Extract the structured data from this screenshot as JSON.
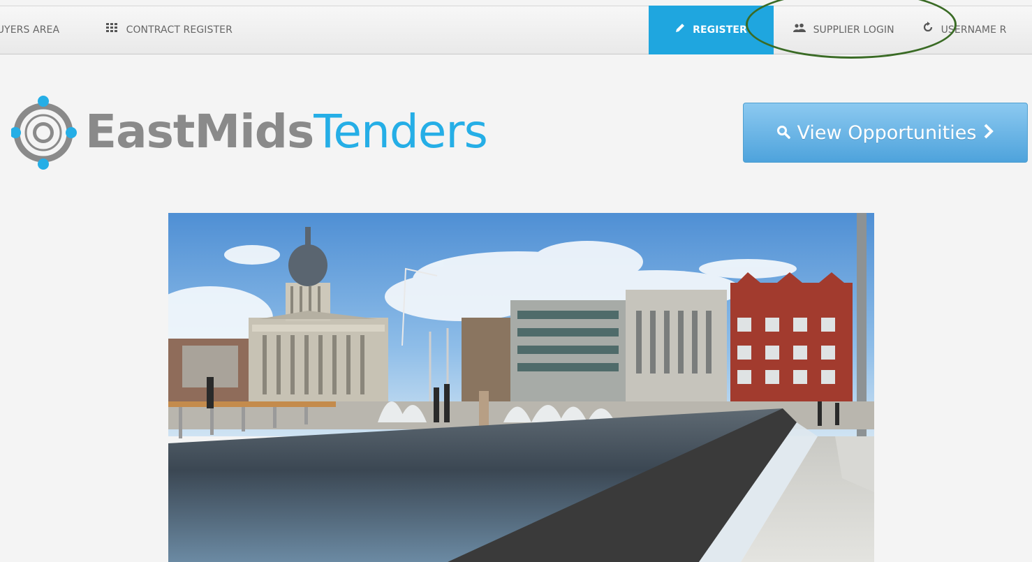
{
  "nav": {
    "buyers_area": "BUYERS AREA",
    "contract_register": "CONTRACT REGISTER",
    "register": "REGISTER",
    "supplier_login": "SUPPLIER LOGIN",
    "username_reminder": "USERNAME R"
  },
  "logo": {
    "part1": "EastMids",
    "part2": "Tenders"
  },
  "cta": {
    "view_opportunities": "View Opportunities"
  },
  "colors": {
    "accent": "#1fa6df",
    "logo_blue": "#25aee6",
    "logo_grey": "#8a8a8a",
    "annotation": "#3a6b25"
  },
  "hero": {
    "icon": "town-square-photo"
  }
}
